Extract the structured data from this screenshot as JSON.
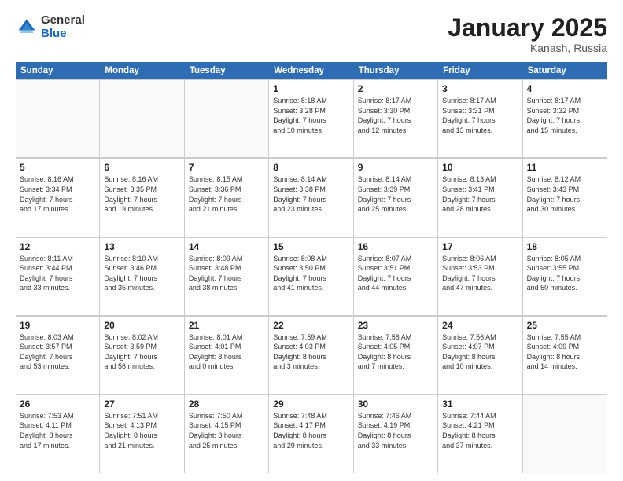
{
  "logo": {
    "general": "General",
    "blue": "Blue"
  },
  "title": "January 2025",
  "location": "Kanash, Russia",
  "days": [
    "Sunday",
    "Monday",
    "Tuesday",
    "Wednesday",
    "Thursday",
    "Friday",
    "Saturday"
  ],
  "weeks": [
    [
      {
        "day": "",
        "info": ""
      },
      {
        "day": "",
        "info": ""
      },
      {
        "day": "",
        "info": ""
      },
      {
        "day": "1",
        "info": "Sunrise: 8:18 AM\nSunset: 3:28 PM\nDaylight: 7 hours\nand 10 minutes."
      },
      {
        "day": "2",
        "info": "Sunrise: 8:17 AM\nSunset: 3:30 PM\nDaylight: 7 hours\nand 12 minutes."
      },
      {
        "day": "3",
        "info": "Sunrise: 8:17 AM\nSunset: 3:31 PM\nDaylight: 7 hours\nand 13 minutes."
      },
      {
        "day": "4",
        "info": "Sunrise: 8:17 AM\nSunset: 3:32 PM\nDaylight: 7 hours\nand 15 minutes."
      }
    ],
    [
      {
        "day": "5",
        "info": "Sunrise: 8:16 AM\nSunset: 3:34 PM\nDaylight: 7 hours\nand 17 minutes."
      },
      {
        "day": "6",
        "info": "Sunrise: 8:16 AM\nSunset: 3:35 PM\nDaylight: 7 hours\nand 19 minutes."
      },
      {
        "day": "7",
        "info": "Sunrise: 8:15 AM\nSunset: 3:36 PM\nDaylight: 7 hours\nand 21 minutes."
      },
      {
        "day": "8",
        "info": "Sunrise: 8:14 AM\nSunset: 3:38 PM\nDaylight: 7 hours\nand 23 minutes."
      },
      {
        "day": "9",
        "info": "Sunrise: 8:14 AM\nSunset: 3:39 PM\nDaylight: 7 hours\nand 25 minutes."
      },
      {
        "day": "10",
        "info": "Sunrise: 8:13 AM\nSunset: 3:41 PM\nDaylight: 7 hours\nand 28 minutes."
      },
      {
        "day": "11",
        "info": "Sunrise: 8:12 AM\nSunset: 3:43 PM\nDaylight: 7 hours\nand 30 minutes."
      }
    ],
    [
      {
        "day": "12",
        "info": "Sunrise: 8:11 AM\nSunset: 3:44 PM\nDaylight: 7 hours\nand 33 minutes."
      },
      {
        "day": "13",
        "info": "Sunrise: 8:10 AM\nSunset: 3:46 PM\nDaylight: 7 hours\nand 35 minutes."
      },
      {
        "day": "14",
        "info": "Sunrise: 8:09 AM\nSunset: 3:48 PM\nDaylight: 7 hours\nand 38 minutes."
      },
      {
        "day": "15",
        "info": "Sunrise: 8:08 AM\nSunset: 3:50 PM\nDaylight: 7 hours\nand 41 minutes."
      },
      {
        "day": "16",
        "info": "Sunrise: 8:07 AM\nSunset: 3:51 PM\nDaylight: 7 hours\nand 44 minutes."
      },
      {
        "day": "17",
        "info": "Sunrise: 8:06 AM\nSunset: 3:53 PM\nDaylight: 7 hours\nand 47 minutes."
      },
      {
        "day": "18",
        "info": "Sunrise: 8:05 AM\nSunset: 3:55 PM\nDaylight: 7 hours\nand 50 minutes."
      }
    ],
    [
      {
        "day": "19",
        "info": "Sunrise: 8:03 AM\nSunset: 3:57 PM\nDaylight: 7 hours\nand 53 minutes."
      },
      {
        "day": "20",
        "info": "Sunrise: 8:02 AM\nSunset: 3:59 PM\nDaylight: 7 hours\nand 56 minutes."
      },
      {
        "day": "21",
        "info": "Sunrise: 8:01 AM\nSunset: 4:01 PM\nDaylight: 8 hours\nand 0 minutes."
      },
      {
        "day": "22",
        "info": "Sunrise: 7:59 AM\nSunset: 4:03 PM\nDaylight: 8 hours\nand 3 minutes."
      },
      {
        "day": "23",
        "info": "Sunrise: 7:58 AM\nSunset: 4:05 PM\nDaylight: 8 hours\nand 7 minutes."
      },
      {
        "day": "24",
        "info": "Sunrise: 7:56 AM\nSunset: 4:07 PM\nDaylight: 8 hours\nand 10 minutes."
      },
      {
        "day": "25",
        "info": "Sunrise: 7:55 AM\nSunset: 4:09 PM\nDaylight: 8 hours\nand 14 minutes."
      }
    ],
    [
      {
        "day": "26",
        "info": "Sunrise: 7:53 AM\nSunset: 4:11 PM\nDaylight: 8 hours\nand 17 minutes."
      },
      {
        "day": "27",
        "info": "Sunrise: 7:51 AM\nSunset: 4:13 PM\nDaylight: 8 hours\nand 21 minutes."
      },
      {
        "day": "28",
        "info": "Sunrise: 7:50 AM\nSunset: 4:15 PM\nDaylight: 8 hours\nand 25 minutes."
      },
      {
        "day": "29",
        "info": "Sunrise: 7:48 AM\nSunset: 4:17 PM\nDaylight: 8 hours\nand 29 minutes."
      },
      {
        "day": "30",
        "info": "Sunrise: 7:46 AM\nSunset: 4:19 PM\nDaylight: 8 hours\nand 33 minutes."
      },
      {
        "day": "31",
        "info": "Sunrise: 7:44 AM\nSunset: 4:21 PM\nDaylight: 8 hours\nand 37 minutes."
      },
      {
        "day": "",
        "info": ""
      }
    ]
  ]
}
